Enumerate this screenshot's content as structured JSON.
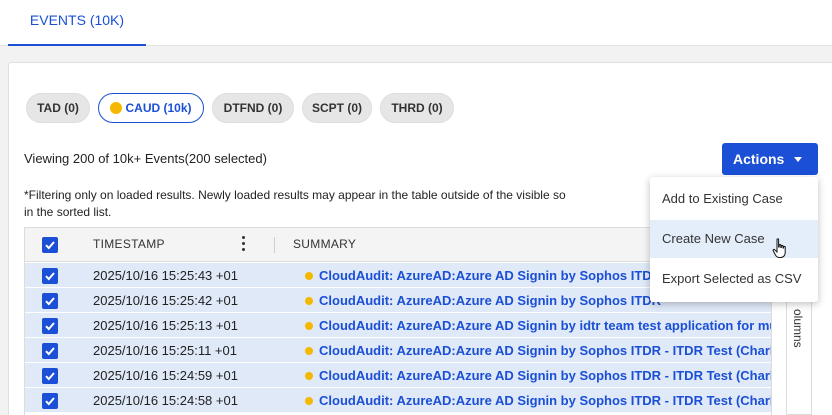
{
  "tabs": [
    {
      "label": "EVENTS (10K)"
    }
  ],
  "filters": [
    {
      "label": "TAD (0)"
    },
    {
      "label": "CAUD (10k)",
      "active": true,
      "icon": "yellow-dot"
    },
    {
      "label": "DTFND (0)"
    },
    {
      "label": "SCPT (0)"
    },
    {
      "label": "THRD (0)"
    }
  ],
  "status": {
    "viewing": "Viewing 200 of 10k+ Events(200 selected)",
    "note_line1": "*Filtering only on loaded results.  Newly loaded results may appear in the table outside of the visible so",
    "note_line2": "in the sorted list."
  },
  "actions": {
    "label": "Actions",
    "menu": [
      "Add to Existing Case",
      "Create New Case",
      "Export Selected as CSV"
    ],
    "hovered_index": 1
  },
  "table": {
    "columns": [
      "TIMESTAMP",
      "SUMMARY"
    ],
    "rows": [
      {
        "timestamp": "2025/10/16 15:25:43 +01",
        "summary": "CloudAudit: AzureAD:Azure AD Signin by Sophos ITDR",
        "checked": true
      },
      {
        "timestamp": "2025/10/16 15:25:42 +01",
        "summary": "CloudAudit: AzureAD:Azure AD Signin by Sophos ITDR",
        "checked": true
      },
      {
        "timestamp": "2025/10/16 15:25:13 +01",
        "summary": "CloudAudit: AzureAD:Azure AD Signin by idtr team test application for mu",
        "checked": true
      },
      {
        "timestamp": "2025/10/16 15:25:11 +01",
        "summary": "CloudAudit: AzureAD:Azure AD Signin by Sophos ITDR - ITDR Test (Charl",
        "checked": true
      },
      {
        "timestamp": "2025/10/16 15:24:59 +01",
        "summary": "CloudAudit: AzureAD:Azure AD Signin by Sophos ITDR - ITDR Test (Charl",
        "checked": true
      },
      {
        "timestamp": "2025/10/16 15:24:58 +01",
        "summary": "CloudAudit: AzureAD:Azure AD Signin by Sophos ITDR - ITDR Test (Charl",
        "checked": true
      }
    ]
  },
  "side_panel": {
    "label": "olumns"
  },
  "colors": {
    "accent": "#1a4fd6",
    "status_dot": "#f5b800",
    "row_selected": "#dfe9f7"
  }
}
